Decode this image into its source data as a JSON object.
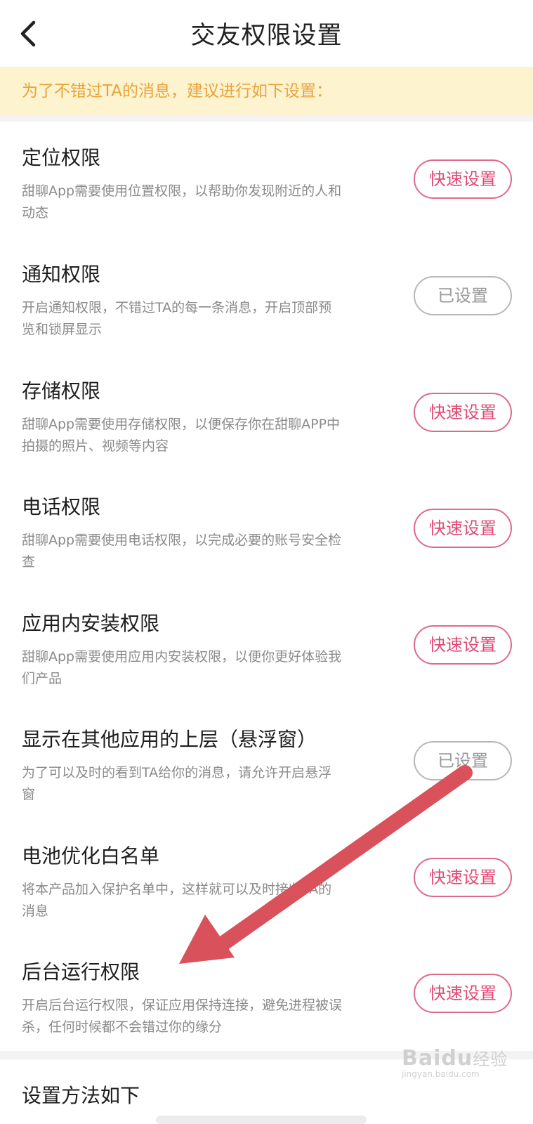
{
  "header": {
    "title": "交友权限设置"
  },
  "banner": {
    "text": "为了不错过TA的消息，建议进行如下设置："
  },
  "items": [
    {
      "title": "定位权限",
      "desc": "甜聊App需要使用位置权限，以帮助你发现附近的人和动态",
      "button": "快速设置",
      "status": "pending"
    },
    {
      "title": "通知权限",
      "desc": "开启通知权限，不错过TA的每一条消息，开启顶部预览和锁屏显示",
      "button": "已设置",
      "status": "done"
    },
    {
      "title": "存储权限",
      "desc": "甜聊App需要使用存储权限，以便保存你在甜聊APP中拍摄的照片、视频等内容",
      "button": "快速设置",
      "status": "pending"
    },
    {
      "title": "电话权限",
      "desc": "甜聊App需要使用电话权限，以完成必要的账号安全检查",
      "button": "快速设置",
      "status": "pending"
    },
    {
      "title": "应用内安装权限",
      "desc": "甜聊App需要使用应用内安装权限，以便你更好体验我们产品",
      "button": "快速设置",
      "status": "pending"
    },
    {
      "title": "显示在其他应用的上层（悬浮窗）",
      "desc": "为了可以及时的看到TA给你的消息，请允许开启悬浮窗",
      "button": "已设置",
      "status": "done"
    },
    {
      "title": "电池优化白名单",
      "desc": "将本产品加入保护名单中，这样就可以及时接收TA的消息",
      "button": "快速设置",
      "status": "pending"
    },
    {
      "title": "后台运行权限",
      "desc": "开启后台运行权限，保证应用保持连接，避免进程被误杀，任何时候都不会错过你的缘分",
      "button": "快速设置",
      "status": "pending"
    }
  ],
  "footer": {
    "section_title": "设置方法如下"
  },
  "watermark": {
    "logo": "Baidu",
    "logo_suffix": "经验",
    "url": "jingyan.baidu.com"
  },
  "colors": {
    "accent": "#e04b75",
    "banner_bg": "#fdf3cf",
    "banner_text": "#e8a33a",
    "arrow": "#d9515a"
  }
}
